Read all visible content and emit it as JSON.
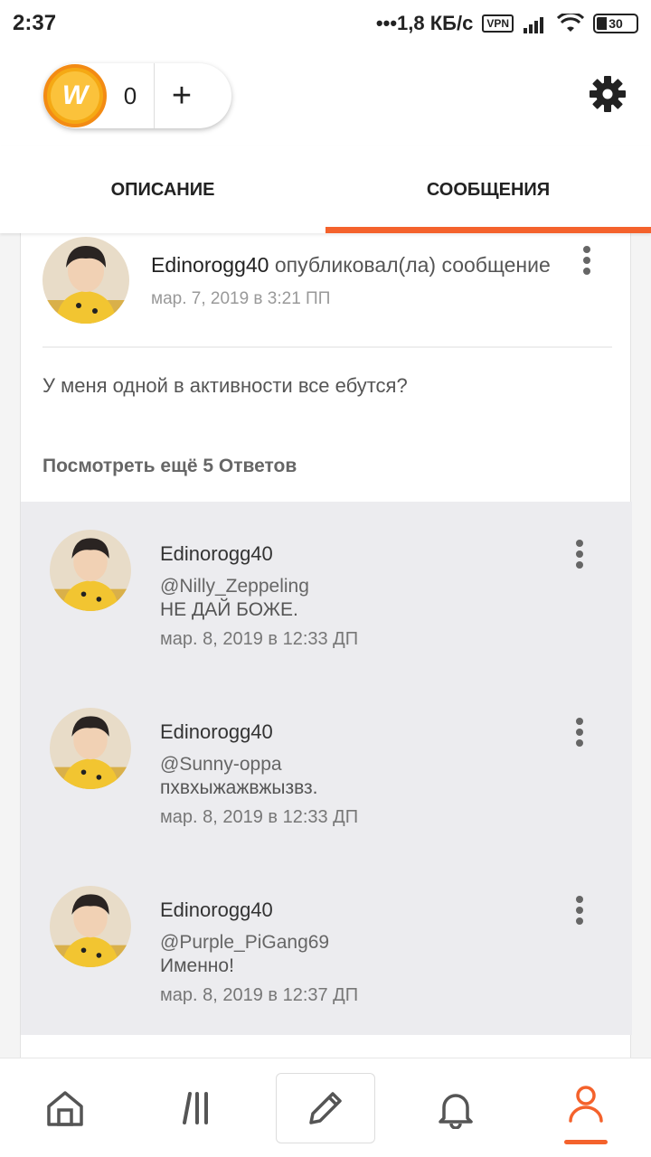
{
  "status_bar": {
    "time": "2:37",
    "speed": "•••1,8 КБ/с",
    "vpn": "VPN",
    "battery": "30"
  },
  "wallet": {
    "coins": "0",
    "coin_symbol": "W",
    "add_label": "+"
  },
  "tabs": [
    {
      "label": "ОПИСАНИЕ",
      "active": false
    },
    {
      "label": "СООБЩЕНИЯ",
      "active": true
    }
  ],
  "post": {
    "author": "Edinorogg40",
    "action": "опубликовал(ла) сообщение",
    "date": "мар. 7, 2019 в 3:21 ПП",
    "body": "У меня  одной в активности все ебутся?",
    "more_replies": "Посмотреть ещё 5 Ответов"
  },
  "replies": [
    {
      "author": "Edinorogg40",
      "mention": "@Nilly_Zeppeling",
      "text": "НЕ ДАЙ БОЖЕ.",
      "date": "мар. 8, 2019 в 12:33 ДП"
    },
    {
      "author": "Edinorogg40",
      "mention": "@Sunny-oppa",
      "text": "пхвхыжажвжызвз.",
      "date": "мар. 8, 2019 в 12:33 ДП"
    },
    {
      "author": "Edinorogg40",
      "mention": "@Purple_PiGang69",
      "text": "Именно!",
      "date": "мар. 8, 2019 в 12:37 ДП"
    }
  ],
  "bottom_nav": [
    {
      "icon": "home-icon"
    },
    {
      "icon": "library-icon"
    },
    {
      "icon": "pencil-icon"
    },
    {
      "icon": "bell-icon"
    },
    {
      "icon": "profile-icon",
      "active": true
    }
  ],
  "colors": {
    "accent": "#f4622c",
    "coin": "#f5a914"
  }
}
